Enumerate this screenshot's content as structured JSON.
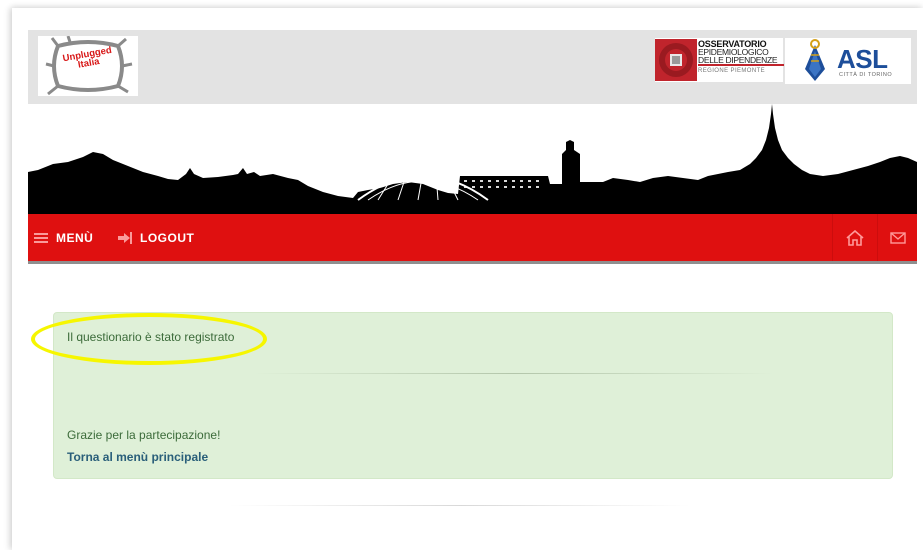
{
  "header": {
    "logo_left": {
      "line1": "Unplugged",
      "line2": "Italia"
    },
    "logo_oed": {
      "line1": "OSSERVATORIO",
      "line2": "EPIDEMIOLOGICO",
      "line3": "DELLE DIPENDENZE",
      "line4": "REGIONE PIEMONTE"
    },
    "logo_asl": {
      "title": "ASL",
      "subtitle": "CITTÀ DI TORINO"
    }
  },
  "nav": {
    "menu_label": "MENÙ",
    "logout_label": "LOGOUT",
    "icons": {
      "menu": "list-icon",
      "logout": "sign-out-icon",
      "home": "home-icon",
      "mail": "envelope-icon"
    }
  },
  "alert": {
    "message": "Il questionario è stato registrato",
    "thanks": "Grazie per la partecipazione!",
    "link": "Torna al menù principale"
  },
  "colors": {
    "nav_red": "#df1010",
    "alert_bg": "#dff0d8",
    "alert_text": "#3c6b3a",
    "link": "#2a5f7a",
    "highlight": "#f6f600",
    "asl_blue": "#1d4e9a",
    "oed_red": "#c0242c"
  }
}
